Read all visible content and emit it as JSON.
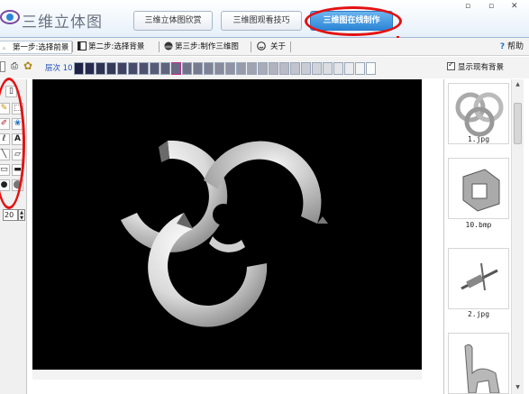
{
  "app": {
    "title": "三维立体图",
    "tabs": [
      {
        "label": "三维立体图欣赏",
        "active": false
      },
      {
        "label": "三维图观看技巧",
        "active": false
      },
      {
        "label": "三维图在线制作",
        "active": true
      }
    ]
  },
  "steps": [
    {
      "label": "第一步:选择前景",
      "active": true
    },
    {
      "label": "第二步:选择背景",
      "active": false
    },
    {
      "label": "第三步:制作三维图",
      "active": false
    },
    {
      "label": "关于",
      "active": false
    }
  ],
  "help_label": "帮助",
  "layer": {
    "label": "层次 10",
    "swatch_count": 28,
    "selected_index": 9
  },
  "show_existing_bg": {
    "label": "显示现有背景",
    "checked": true
  },
  "tools": {
    "stepper_value": "20",
    "icons": [
      "new-page-icon",
      "print-icon",
      "fill-icon",
      "pencil-icon",
      "rect-select-icon",
      "eyedropper-icon",
      "color-replace-icon",
      "brush-icon",
      "text-icon",
      "line-icon",
      "eraser-icon",
      "rectangle-icon",
      "filled-rectangle-icon",
      "circle-icon",
      "sphere-icon"
    ]
  },
  "thumbnails": [
    {
      "label": "1.jpg"
    },
    {
      "label": "10.bmp"
    },
    {
      "label": "2.jpg"
    },
    {
      "label": ""
    }
  ],
  "colors": {
    "accent": "#2b86d6",
    "annotation_red": "#e31212",
    "canvas_bg": "#000000"
  }
}
